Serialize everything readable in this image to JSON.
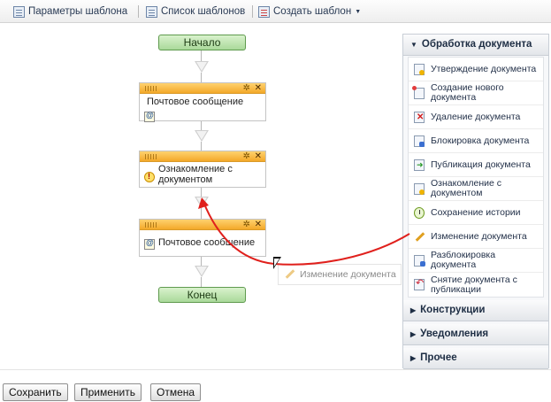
{
  "toolbar": {
    "template_params": "Параметры шаблона",
    "template_list": "Список шаблонов",
    "create_template": "Создать шаблон"
  },
  "flow": {
    "start": "Начало",
    "end": "Конец",
    "steps": [
      {
        "label": "Почтовое сообщение",
        "icon": "mail-icon"
      },
      {
        "label": "Ознакомление с документом",
        "icon": "warning-icon"
      },
      {
        "label": "Почтовое сообщение",
        "icon": "mail-icon"
      }
    ]
  },
  "palette": {
    "sections": [
      {
        "title": "Обработка документа",
        "expanded": true
      },
      {
        "title": "Конструкции",
        "expanded": false
      },
      {
        "title": "Уведомления",
        "expanded": false
      },
      {
        "title": "Прочее",
        "expanded": false
      }
    ],
    "items": [
      {
        "label": "Утверждение документа",
        "icon": "doc-approve-icon"
      },
      {
        "label": "Создание нового документа",
        "icon": "doc-new-icon"
      },
      {
        "label": "Удаление документа",
        "icon": "doc-delete-icon"
      },
      {
        "label": "Блокировка документа",
        "icon": "doc-lock-icon"
      },
      {
        "label": "Публикация документа",
        "icon": "doc-publish-icon"
      },
      {
        "label": "Ознакомление с документом",
        "icon": "doc-review-icon"
      },
      {
        "label": "Сохранение истории",
        "icon": "history-icon"
      },
      {
        "label": "Изменение документа",
        "icon": "pencil-icon"
      },
      {
        "label": "Разблокировка документа",
        "icon": "doc-unlock-icon"
      },
      {
        "label": "Снятие документа с публикации",
        "icon": "doc-unpublish-icon"
      }
    ]
  },
  "drag": {
    "label": "Изменение документа"
  },
  "buttons": {
    "save": "Сохранить",
    "apply": "Применить",
    "cancel": "Отмена"
  },
  "colors": {
    "arrow": "#e0201c",
    "step_header": "#f3a829",
    "terminal": "#a9d99a"
  }
}
